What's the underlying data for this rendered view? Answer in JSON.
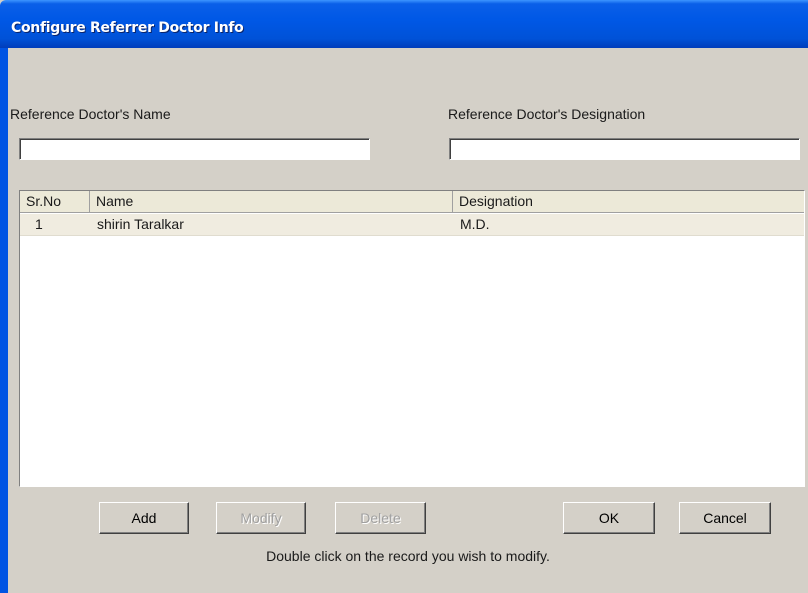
{
  "window": {
    "title": "Configure Referrer Doctor Info"
  },
  "form": {
    "name_label": "Reference Doctor's Name",
    "name_value": "",
    "designation_label": "Reference Doctor's Designation",
    "designation_value": ""
  },
  "table": {
    "columns": [
      "Sr.No",
      "Name",
      "Designation"
    ],
    "rows": [
      {
        "sr_no": "1",
        "name": "shirin Taralkar",
        "designation": "M.D."
      }
    ]
  },
  "buttons": {
    "add": "Add",
    "modify": "Modify",
    "delete": "Delete",
    "ok": "OK",
    "cancel": "Cancel"
  },
  "hint": "Double click on the record you wish to modify.",
  "colors": {
    "titlebar": "#0058e6",
    "dialog_bg": "#d4d0c8",
    "row_bg": "#f0ece0"
  }
}
